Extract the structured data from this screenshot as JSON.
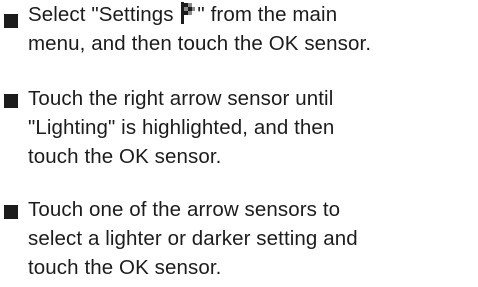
{
  "instructions": [
    {
      "lines": [
        {
          "before_icon": "Select \"Settings ",
          "icon": "settings-flag-icon",
          "after_icon": "\" from the main"
        },
        "menu, and then touch the OK sensor."
      ]
    },
    {
      "lines": [
        "Touch the right arrow sensor until",
        "\"Lighting\" is highlighted, and then",
        "touch the OK sensor."
      ]
    },
    {
      "lines": [
        "Touch one of the arrow sensors to",
        "select a lighter or darker setting and",
        "touch the OK sensor."
      ]
    }
  ]
}
